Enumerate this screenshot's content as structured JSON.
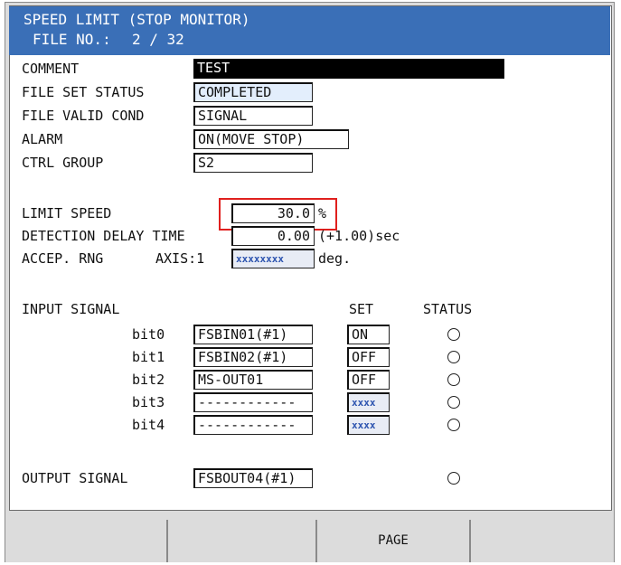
{
  "header": {
    "title": "SPEED LIMIT (STOP MONITOR)",
    "file_no_label": "FILE NO.:",
    "file_no_value": "2 / 32"
  },
  "fields": {
    "comment": {
      "label": "COMMENT",
      "value": "TEST"
    },
    "file_set_status": {
      "label": "FILE SET STATUS",
      "value": "COMPLETED"
    },
    "file_valid_cond": {
      "label": "FILE VALID COND",
      "value": "SIGNAL"
    },
    "alarm": {
      "label": "ALARM",
      "value": "ON(MOVE STOP)"
    },
    "ctrl_group": {
      "label": "CTRL GROUP",
      "value": "S2"
    }
  },
  "limit_speed": {
    "label": "LIMIT SPEED",
    "value": "30.0",
    "unit": "%"
  },
  "detection_delay": {
    "label": "DETECTION DELAY TIME",
    "value": "0.00",
    "suffix": "(+1.00)sec"
  },
  "accep_rng": {
    "label": "ACCEP. RNG",
    "axis_label": "AXIS:1",
    "value": "xxxxxxxx",
    "unit": "deg."
  },
  "input_signal": {
    "label": "INPUT SIGNAL",
    "set_header": "SET",
    "status_header": "STATUS",
    "rows": [
      {
        "bit": "bit0",
        "signal": "FSBIN01(#1)",
        "set": "ON"
      },
      {
        "bit": "bit1",
        "signal": "FSBIN02(#1)",
        "set": "OFF"
      },
      {
        "bit": "bit2",
        "signal": "MS-OUT01",
        "set": "OFF"
      },
      {
        "bit": "bit3",
        "signal": "------------",
        "set": "xxxx"
      },
      {
        "bit": "bit4",
        "signal": "------------",
        "set": "xxxx"
      }
    ]
  },
  "output_signal": {
    "label": "OUTPUT SIGNAL",
    "value": "FSBOUT04(#1)"
  },
  "function_keys": [
    "",
    "",
    "PAGE",
    "",
    ""
  ],
  "colors": {
    "title_bg": "#3a6fb7",
    "highlight": "#e0201e",
    "panel_bg": "#ffffff",
    "frame_bg": "#dcdcdc"
  }
}
